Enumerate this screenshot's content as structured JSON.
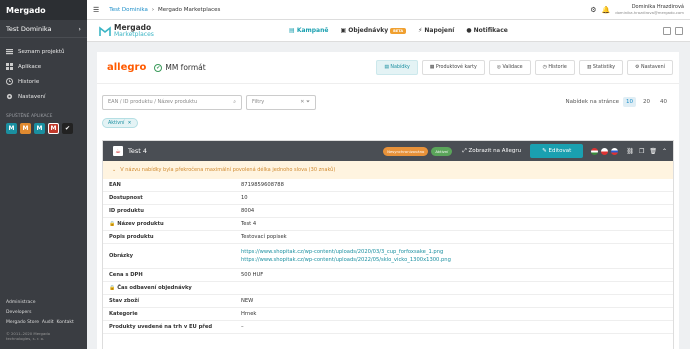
{
  "sidebar": {
    "brand": "Mergado",
    "project": "Test Dominika",
    "items": [
      {
        "label": "Seznam projektů",
        "icon": "list-icon"
      },
      {
        "label": "Aplikace",
        "icon": "grid-icon"
      },
      {
        "label": "Historie",
        "icon": "clock-icon"
      },
      {
        "label": "Nastavení",
        "icon": "gear-icon"
      }
    ],
    "section": "SPUŠTĚNÉ APLIKACE",
    "apps": [
      "M",
      "M",
      "M",
      "M",
      "✔"
    ],
    "bottom_links": [
      "Administrace",
      "Developers"
    ],
    "footer_links": [
      "Mergado Store",
      "Audit",
      "Kontakt"
    ],
    "copyright": "© 2011–2020 Mergado technologies, s. r. o."
  },
  "topbar": {
    "crumb1": "Test Dominika",
    "crumb2": "Mergado Marketplaces",
    "user_name": "Dominika Hrazdirová",
    "user_email": "dominika.hrazdirova@mergado.com"
  },
  "app_header": {
    "logo_title": "Mergado",
    "logo_sub": "Marketplaces",
    "nav": [
      {
        "label": "Kampaně"
      },
      {
        "label": "Objednávky",
        "badge": "BETA"
      },
      {
        "label": "Napojení"
      },
      {
        "label": "Notifikace"
      }
    ]
  },
  "panel": {
    "marketplace": "allegro",
    "format_name": "MM formát",
    "tabs": [
      "Nabídky",
      "Produktové karty",
      "Validace",
      "Historie",
      "Statistiky",
      "Nastavení"
    ],
    "search_placeholder": "EAN / ID produktu / Název produktu",
    "filter_placeholder": "Filtry",
    "per_page_label": "Nabídek na stránce",
    "per_page_options": [
      "10",
      "20",
      "40"
    ],
    "active_chip": "Aktivní"
  },
  "offer": {
    "title": "Test 4",
    "badge_unsync": "Nesynchronizováno",
    "badge_active": "Aktivní",
    "show_link": "Zobrazit na Allegru",
    "edit_button": "Editovat",
    "warning": "V názvu nabídky byla překročena maximální povolená délka jednoho slova (30 znaků)",
    "rows": [
      {
        "k": "EAN",
        "v": "8719859608788"
      },
      {
        "k": "Dostupnost",
        "v": "10"
      },
      {
        "k": "ID produktu",
        "v": "8004"
      },
      {
        "k": "Název produktu",
        "v": "Test 4",
        "lock": true
      },
      {
        "k": "Popis produktu",
        "v": "Testovací popisek"
      },
      {
        "k": "Obrázky",
        "links": [
          "https://www.shopitak.cz/wp-content/uploads/2020/03/3_cup_forfoxsake_1.png",
          "https://www.shopitak.cz/wp-content/uploads/2022/05/sklo_vicko_1300x1300.png"
        ]
      },
      {
        "k": "Cena s DPH",
        "v": "500 HUF"
      },
      {
        "k": "Čas odbavení objednávky",
        "v": "",
        "lock": true
      },
      {
        "k": "Stav zboží",
        "v": "NEW"
      },
      {
        "k": "Kategorie",
        "v": "Hrnek"
      },
      {
        "k": "Produkty uvedené na trh v EU před",
        "v": "–"
      }
    ]
  }
}
